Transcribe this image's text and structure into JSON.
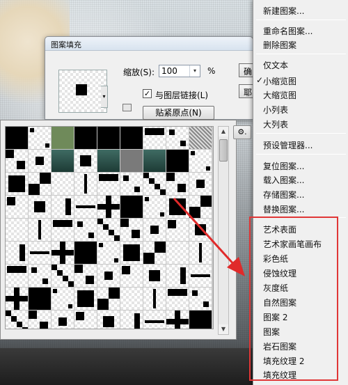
{
  "dialog": {
    "title": "图案填充",
    "scale_label": "缩放(S):",
    "scale_value": "100",
    "scale_unit": "%",
    "link_layer_checked": true,
    "link_layer_label": "与图层链接(L)",
    "snap_button": "贴紧原点(N)",
    "ok_label": "确",
    "cancel_label": "耶"
  },
  "picker": {
    "gear_label": "⚙.",
    "scroll_up": "▲",
    "scroll_down": "▼"
  },
  "menu": {
    "items": [
      "新建图案...",
      "重命名图案...",
      "删除图案",
      "仅文本",
      "小缩览图",
      "大缩览图",
      "小列表",
      "大列表",
      "预设管理器...",
      "复位图案...",
      "载入图案...",
      "存储图案...",
      "替换图案..."
    ],
    "checked_item": "小缩览图",
    "check_mark": "✓",
    "library_items": [
      "艺术表面",
      "艺术家画笔画布",
      "彩色纸",
      "侵蚀纹理",
      "灰度纸",
      "自然图案",
      "图案 2",
      "图案",
      "岩石图案",
      "填充纹理 2",
      "填充纹理"
    ]
  },
  "colors": {
    "highlight_box": "#e03636",
    "arrow": "#e02a2a",
    "menu_bg": "#f0f0f0"
  }
}
